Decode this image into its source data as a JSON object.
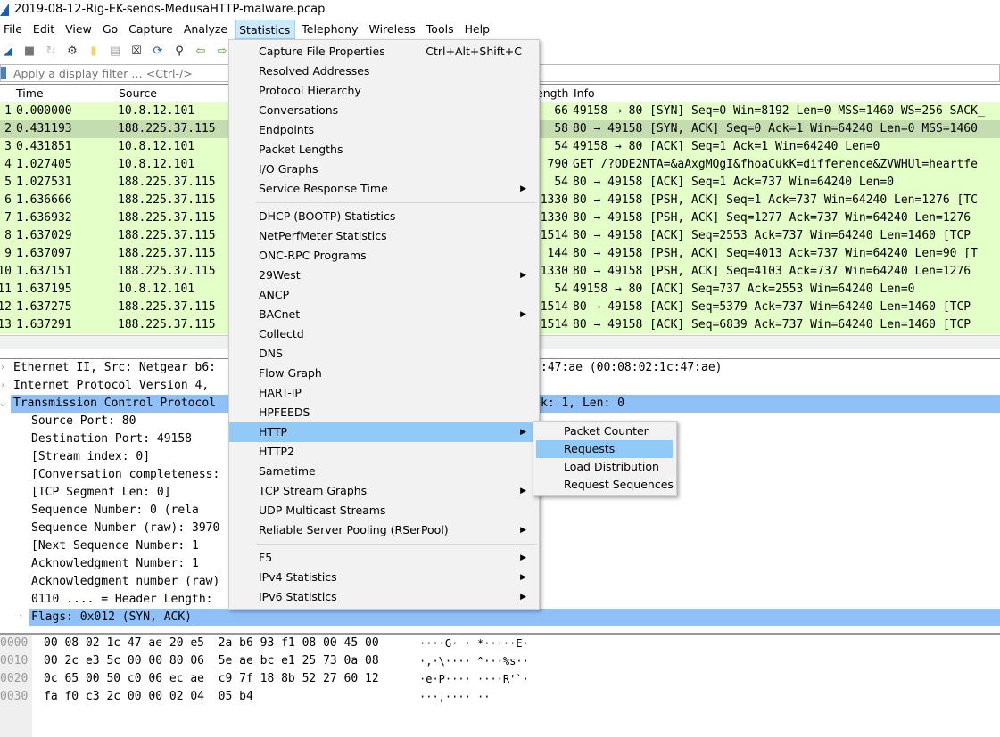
{
  "window": {
    "title": "2019-08-12-Rig-EK-sends-MedusaHTTP-malware.pcap"
  },
  "menubar": [
    "File",
    "Edit",
    "View",
    "Go",
    "Capture",
    "Analyze",
    "Statistics",
    "Telephony",
    "Wireless",
    "Tools",
    "Help"
  ],
  "toolbar": [
    "shark-fin-start-icon",
    "stop-icon",
    "restart-icon",
    "options-gear-icon",
    "open-file-icon",
    "save-file-icon",
    "close-file-icon",
    "reload-icon",
    "find-icon",
    "back-arrow-icon",
    "forward-arrow-icon"
  ],
  "filter": {
    "placeholder": "Apply a display filter … <Ctrl-/>"
  },
  "packet_list": {
    "columns": [
      "Time",
      "Source",
      "ength",
      "Info"
    ],
    "rows": [
      {
        "no": "1",
        "time": "0.000000",
        "src": "10.8.12.101",
        "len": "66",
        "info": "49158 → 80 [SYN] Seq=0 Win=8192 Len=0 MSS=1460 WS=256 SACK_"
      },
      {
        "no": "2",
        "time": "0.431193",
        "src": "188.225.37.115",
        "len": "58",
        "info": "80 → 49158 [SYN, ACK] Seq=0 Ack=1 Win=64240 Len=0 MSS=1460"
      },
      {
        "no": "3",
        "time": "0.431851",
        "src": "10.8.12.101",
        "len": "54",
        "info": "49158 → 80 [ACK] Seq=1 Ack=1 Win=64240 Len=0"
      },
      {
        "no": "4",
        "time": "1.027405",
        "src": "10.8.12.101",
        "len": "790",
        "info": "GET /?ODE2NTA=&aAxgMQgI&fhoaCukK=difference&ZVWHUl=heartfe"
      },
      {
        "no": "5",
        "time": "1.027531",
        "src": "188.225.37.115",
        "len": "54",
        "info": "80 → 49158 [ACK] Seq=1 Ack=737 Win=64240 Len=0"
      },
      {
        "no": "6",
        "time": "1.636666",
        "src": "188.225.37.115",
        "len": "1330",
        "info": "80 → 49158 [PSH, ACK] Seq=1 Ack=737 Win=64240 Len=1276 [TC"
      },
      {
        "no": "7",
        "time": "1.636932",
        "src": "188.225.37.115",
        "len": "1330",
        "info": "80 → 49158 [PSH, ACK] Seq=1277 Ack=737 Win=64240 Len=1276"
      },
      {
        "no": "8",
        "time": "1.637029",
        "src": "188.225.37.115",
        "len": "1514",
        "info": "80 → 49158 [ACK] Seq=2553 Ack=737 Win=64240 Len=1460 [TCP"
      },
      {
        "no": "9",
        "time": "1.637097",
        "src": "188.225.37.115",
        "len": "144",
        "info": "80 → 49158 [PSH, ACK] Seq=4013 Ack=737 Win=64240 Len=90 [T"
      },
      {
        "no": "10",
        "time": "1.637151",
        "src": "188.225.37.115",
        "len": "1330",
        "info": "80 → 49158 [PSH, ACK] Seq=4103 Ack=737 Win=64240 Len=1276"
      },
      {
        "no": "11",
        "time": "1.637195",
        "src": "10.8.12.101",
        "len": "54",
        "info": "49158 → 80 [ACK] Seq=737 Ack=2553 Win=64240 Len=0"
      },
      {
        "no": "12",
        "time": "1.637275",
        "src": "188.225.37.115",
        "len": "1514",
        "info": "80 → 49158 [ACK] Seq=5379 Ack=737 Win=64240 Len=1460 [TCP"
      },
      {
        "no": "13",
        "time": "1.637291",
        "src": "188.225.37.115",
        "len": "1514",
        "info": "80 → 49158 [ACK] Seq=6839 Ack=737 Win=64240 Len=1460 [TCP"
      }
    ],
    "selected_row": 2
  },
  "details": [
    {
      "arrow": "›",
      "indent": 0,
      "text": "Ethernet II, Src: Netgear_b6:",
      "tail": ":47:ae (00:08:02:1c:47:ae)"
    },
    {
      "arrow": "›",
      "indent": 0,
      "text": "Internet Protocol Version 4,",
      "tail": ""
    },
    {
      "arrow": "⌄",
      "indent": 0,
      "text": "Transmission Control Protocol",
      "tail": "k: 1, Len: 0",
      "hl": true
    },
    {
      "indent": 1,
      "text": "Source Port: 80"
    },
    {
      "indent": 1,
      "text": "Destination Port: 49158"
    },
    {
      "indent": 1,
      "text": "[Stream index: 0]"
    },
    {
      "indent": 1,
      "text": "[Conversation completeness:"
    },
    {
      "indent": 1,
      "text": "[TCP Segment Len: 0]"
    },
    {
      "indent": 1,
      "text": "Sequence Number: 0    (rela"
    },
    {
      "indent": 1,
      "text": "Sequence Number (raw): 3970"
    },
    {
      "indent": 1,
      "text": "[Next Sequence Number: 1"
    },
    {
      "indent": 1,
      "text": "Acknowledgment Number: 1"
    },
    {
      "indent": 1,
      "text": "Acknowledgment number (raw)"
    },
    {
      "indent": 1,
      "text": "0110 .... = Header Length:"
    },
    {
      "arrow": "›",
      "indent": 1,
      "text": "Flags: 0x012 (SYN, ACK)",
      "hl": true
    }
  ],
  "hex": [
    {
      "off": "0000",
      "bytes": "00 08 02 1c 47 ae 20 e5  2a b6 93 f1 08 00 45 00",
      "ascii": "····G· · *·····E·"
    },
    {
      "off": "0010",
      "bytes": "00 2c e3 5c 00 00 80 06  5e ae bc e1 25 73 0a 08",
      "ascii": "·,·\\···· ^···%s··"
    },
    {
      "off": "0020",
      "bytes": "0c 65 00 50 c0 06 ec ae  c9 7f 18 8b 52 27 60 12",
      "ascii": "·e·P···· ····R'`·"
    },
    {
      "off": "0030",
      "bytes": "fa f0 c3 2c 00 00 02 04  05 b4",
      "ascii": "···,···· ··"
    }
  ],
  "statistics_menu": [
    {
      "label": "Capture File Properties",
      "shortcut": "Ctrl+Alt+Shift+C"
    },
    {
      "label": "Resolved Addresses"
    },
    {
      "label": "Protocol Hierarchy"
    },
    {
      "label": "Conversations"
    },
    {
      "label": "Endpoints"
    },
    {
      "label": "Packet Lengths"
    },
    {
      "label": "I/O Graphs"
    },
    {
      "label": "Service Response Time",
      "sub": true
    },
    {
      "sep": true
    },
    {
      "label": "DHCP (BOOTP) Statistics"
    },
    {
      "label": "NetPerfMeter Statistics"
    },
    {
      "label": "ONC-RPC Programs"
    },
    {
      "label": "29West",
      "sub": true
    },
    {
      "label": "ANCP"
    },
    {
      "label": "BACnet",
      "sub": true
    },
    {
      "label": "Collectd"
    },
    {
      "label": "DNS"
    },
    {
      "label": "Flow Graph"
    },
    {
      "label": "HART-IP"
    },
    {
      "label": "HPFEEDS"
    },
    {
      "label": "HTTP",
      "sub": true,
      "hl": true
    },
    {
      "label": "HTTP2"
    },
    {
      "label": "Sametime"
    },
    {
      "label": "TCP Stream Graphs",
      "sub": true
    },
    {
      "label": "UDP Multicast Streams"
    },
    {
      "label": "Reliable Server Pooling (RSerPool)",
      "sub": true
    },
    {
      "sep": true
    },
    {
      "label": "F5",
      "sub": true
    },
    {
      "label": "IPv4 Statistics",
      "sub": true
    },
    {
      "label": "IPv6 Statistics",
      "sub": true
    }
  ],
  "http_submenu": [
    {
      "label": "Packet Counter"
    },
    {
      "label": "Requests",
      "hl": true
    },
    {
      "label": "Load Distribution"
    },
    {
      "label": "Request Sequences"
    }
  ],
  "colors": {
    "tcp_row": "#e4ffc7",
    "selected_row": "#c5dbb0",
    "highlight": "#90c0f8",
    "menu_hover": "#91c9f7"
  }
}
